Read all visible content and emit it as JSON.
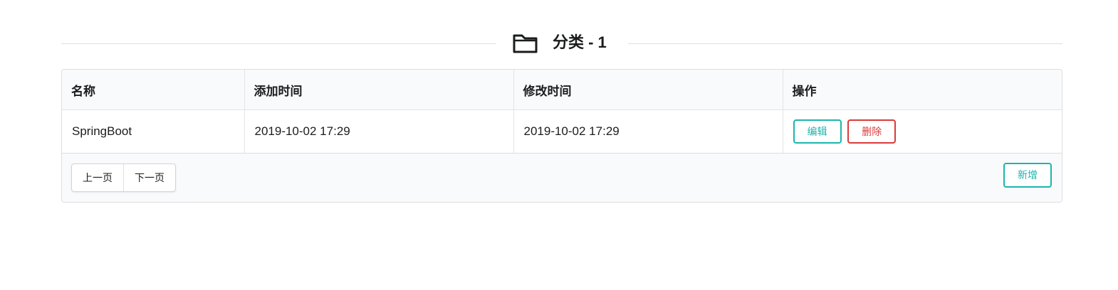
{
  "header": {
    "icon": "folder-icon",
    "title": "分类 - 1"
  },
  "table": {
    "columns": [
      "名称",
      "添加时间",
      "修改时间",
      "操作"
    ],
    "rows": [
      {
        "name": "SpringBoot",
        "created": "2019-10-02 17:29",
        "modified": "2019-10-02 17:29",
        "edit_label": "编辑",
        "delete_label": "删除"
      }
    ]
  },
  "footer": {
    "prev_label": "上一页",
    "next_label": "下一页",
    "add_label": "新增"
  },
  "colors": {
    "primary": "#1ab5ad",
    "danger": "#db3a3a",
    "table_header_bg": "#f9fafb",
    "border": "#dddee0"
  }
}
